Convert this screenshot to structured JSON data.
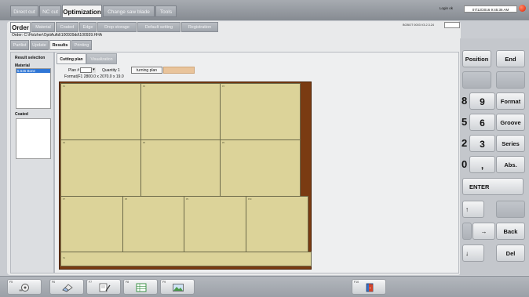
{
  "top_tabs": [
    {
      "label": "Direct cut",
      "active": false
    },
    {
      "label": "NC cut",
      "active": false
    },
    {
      "label": "Optimization",
      "active": true
    },
    {
      "label": "Change saw blade",
      "active": false
    },
    {
      "label": "Tools",
      "active": false
    }
  ],
  "header": {
    "login_label": "Login ok",
    "datetime": "07/12/2016  9:45:36 AM",
    "version": "BOBOT 0003 V3.2.3.24"
  },
  "main_tabs": [
    {
      "label": "Order",
      "active": true
    },
    {
      "label": "Material",
      "active": false
    },
    {
      "label": "Coated",
      "active": false
    },
    {
      "label": "Edge",
      "active": false
    },
    {
      "label": "Drop storage",
      "active": false
    },
    {
      "label": "Default setting",
      "active": false
    },
    {
      "label": "Registration",
      "active": false
    }
  ],
  "order_path": "Order: C:\\Holzher\\OptiAuftd\\100939dd\\100939.HHA",
  "sub_tabs": [
    {
      "label": "Partlist",
      "active": false
    },
    {
      "label": "Update",
      "active": false
    },
    {
      "label": "Results",
      "active": true
    },
    {
      "label": "Printing",
      "active": false
    }
  ],
  "left_panel": {
    "result_selection": "Result selection",
    "material_label": "Material",
    "material_selected": "5.645 Bone",
    "coated_label": "Coated"
  },
  "content_tabs": [
    {
      "label": "Cutting plan",
      "active": true
    },
    {
      "label": "Visualization",
      "active": false
    }
  ],
  "plan": {
    "plan_label": "Plan #",
    "quantity_label": "Quantity 1",
    "turning_plan_button": "turning plan",
    "format": "Format(F1 2800.0 x 2070.0 x 19.0"
  },
  "pieces": [
    "P1",
    "P2",
    "P3",
    "P4",
    "P5",
    "P6",
    "P7",
    "P8",
    "P9",
    "P10"
  ],
  "strip_label": "S1",
  "keypad": {
    "position": "Position",
    "end": "End",
    "n8": "8",
    "n9": "9",
    "format": "Format",
    "n5": "5",
    "n6": "6",
    "groove": "Groove",
    "n2": "2",
    "n3": "3",
    "series": "Series",
    "n0": "0",
    "comma": ",",
    "abs": "Abs.",
    "enter": "ENTER",
    "up": "↑",
    "right": "→",
    "down": "↓",
    "back": "Back",
    "del": "Del"
  },
  "toolbar": {
    "keys": [
      "F5",
      "F6",
      "F7",
      "F8",
      "F9",
      "F10"
    ]
  }
}
